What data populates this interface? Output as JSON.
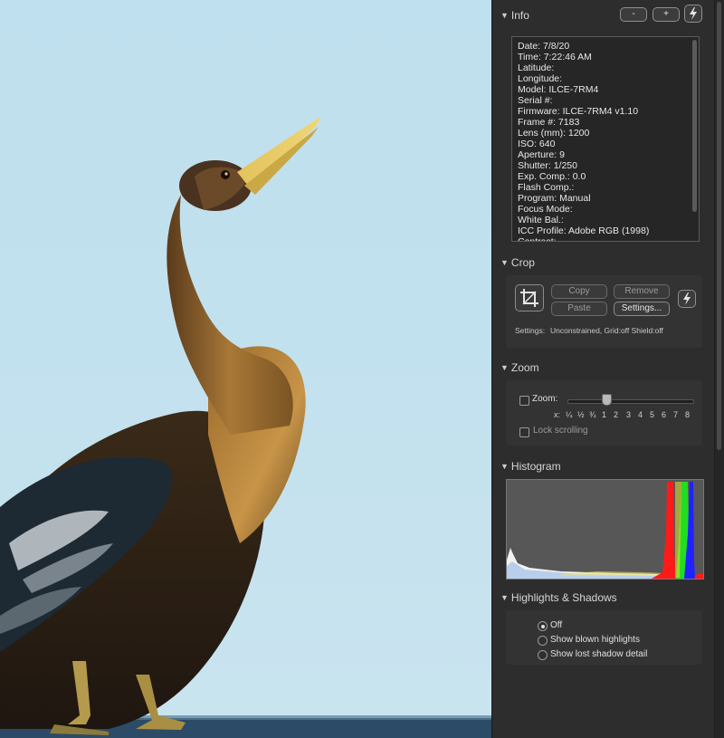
{
  "info": {
    "title": "Info",
    "minus_label": "-",
    "plus_label": "+",
    "action_icon": "lightning-icon",
    "lines": [
      "Date: 7/8/20",
      "Time: 7:22:46 AM",
      "Latitude:",
      "Longitude:",
      "Model: ILCE-7RM4",
      "Serial #:",
      "Firmware: ILCE-7RM4 v1.10",
      "Frame #: 7183",
      "Lens (mm): 1200",
      "ISO: 640",
      "Aperture: 9",
      "Shutter: 1/250",
      "Exp. Comp.: 0.0",
      "Flash Comp.:",
      "Program: Manual",
      "Focus Mode:",
      "White Bal.:",
      "ICC Profile: Adobe RGB (1998)",
      "Contrast:"
    ]
  },
  "crop": {
    "title": "Crop",
    "copy_label": "Copy",
    "remove_label": "Remove",
    "paste_label": "Paste",
    "settings_label": "Settings...",
    "settings_caption": "Settings:",
    "settings_value": "Unconstrained, Grid:off Shield:off"
  },
  "zoom": {
    "title": "Zoom",
    "zoom_label": "Zoom:",
    "x_label": "x:",
    "ticks": [
      "¼",
      "½",
      "¾",
      "1",
      "2",
      "3",
      "4",
      "5",
      "6",
      "7",
      "8"
    ],
    "lock_label": "Lock scrolling",
    "zoom_checked": false,
    "lock_checked": false
  },
  "histogram": {
    "title": "Histogram"
  },
  "highlights": {
    "title": "Highlights & Shadows",
    "options": [
      "Off",
      "Show blown highlights",
      "Show lost shadow detail"
    ],
    "selected": "Off"
  },
  "colors": {
    "panel_bg": "#2d2d2d",
    "sky": "#c1e0ee",
    "histogram_red": "#ff1a1a",
    "histogram_green": "#22dd22",
    "histogram_blue": "#2222ff"
  }
}
